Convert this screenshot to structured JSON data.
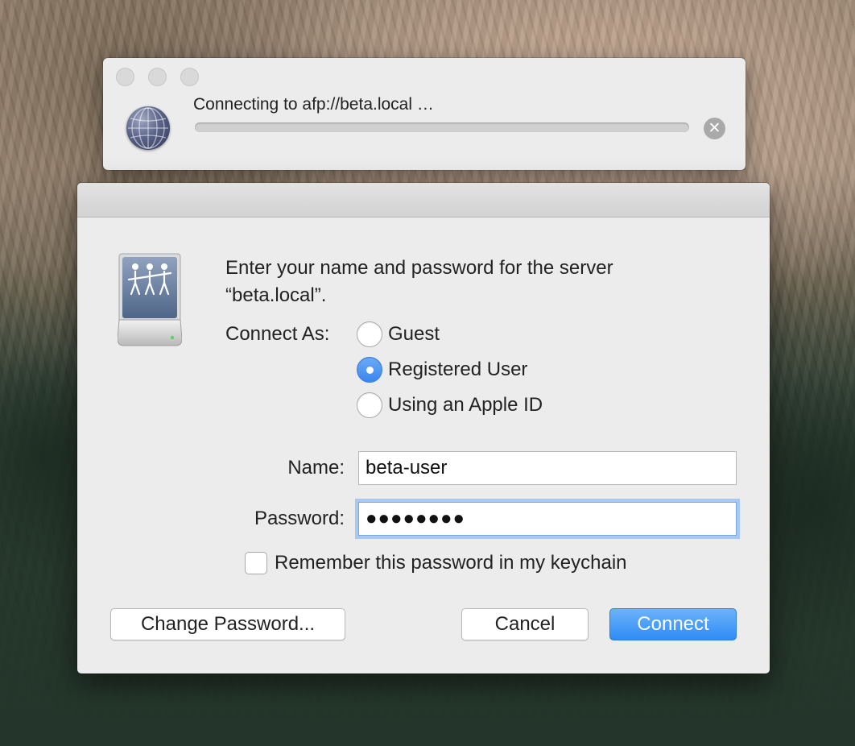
{
  "progress_window": {
    "title": "Connecting to afp://beta.local …",
    "progress": 0,
    "stop_glyph": "✕",
    "icon": "network-globe-icon"
  },
  "dialog": {
    "prompt_line1": "Enter your name and password for the server",
    "prompt_line2": "“beta.local”.",
    "icon": "file-server-icon",
    "connect_as_label": "Connect As:",
    "options": [
      {
        "label": "Guest",
        "checked": false
      },
      {
        "label": "Registered User",
        "checked": true
      },
      {
        "label": "Using an Apple ID",
        "checked": false
      }
    ],
    "name_label": "Name:",
    "name_value": "beta-user",
    "password_label": "Password:",
    "password_value": "●●●●●●●●",
    "remember_label": "Remember this password in my keychain",
    "remember_checked": false,
    "buttons": {
      "change_password": "Change Password...",
      "cancel": "Cancel",
      "connect": "Connect"
    }
  },
  "colors": {
    "accent": "#3b86ee",
    "focus_ring": "#a8c9f2"
  }
}
